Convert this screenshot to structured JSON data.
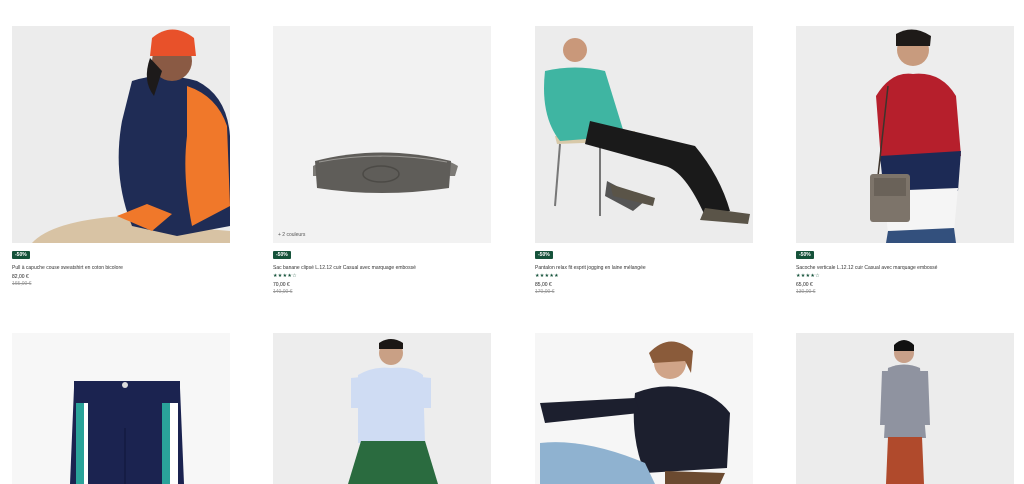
{
  "products": [
    {
      "badge": "-50%",
      "name": "Pull à capuche couse sweatshirt en coton bicolore",
      "stars": "",
      "price": "82,00 €",
      "old_price": "165,00 €",
      "colors_note": ""
    },
    {
      "badge": "-50%",
      "name": "Sac banane clipsé L.12.12 cuir Casual avec marquage embossé",
      "stars": "★★★★☆",
      "price": "70,00 €",
      "old_price": "140,00 €",
      "colors_note": "+ 2 couleurs"
    },
    {
      "badge": "-50%",
      "name": "Pantalon relax fit esprit jogging en laine mélangée",
      "stars": "★★★★★",
      "price": "85,00 €",
      "old_price": "170,00 €",
      "colors_note": ""
    },
    {
      "badge": "-50%",
      "name": "Sacoche verticale L.12.12 cuir Casual avec marquage embossé",
      "stars": "★★★★☆",
      "price": "65,00 €",
      "old_price": "130,00 €",
      "colors_note": ""
    },
    {
      "badge": "",
      "name": "",
      "stars": "",
      "price": "",
      "old_price": "",
      "colors_note": ""
    },
    {
      "badge": "",
      "name": "",
      "stars": "",
      "price": "",
      "old_price": "",
      "colors_note": ""
    },
    {
      "badge": "",
      "name": "",
      "stars": "",
      "price": "",
      "old_price": "",
      "colors_note": ""
    },
    {
      "badge": "",
      "name": "",
      "stars": "",
      "price": "",
      "old_price": "",
      "colors_note": ""
    }
  ],
  "colors": {
    "badge": "#15523a",
    "star": "#15523a"
  }
}
